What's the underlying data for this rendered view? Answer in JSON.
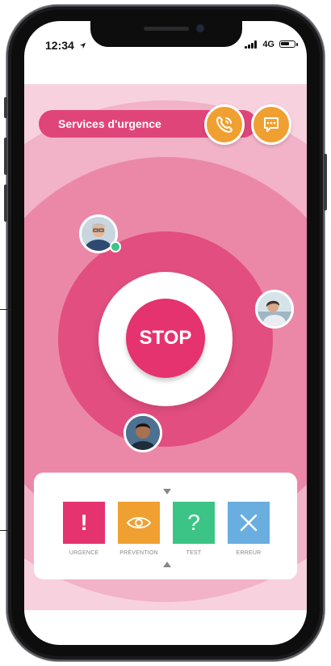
{
  "status": {
    "time": "12:34",
    "network": "4G",
    "battery_level": 0.7
  },
  "services": {
    "label": "Services d'urgence"
  },
  "stop": {
    "label": "STOP"
  },
  "modes": [
    {
      "label": "URGENCE",
      "symbol": "!",
      "color": "#e5336f"
    },
    {
      "label": "PRÉVENTION",
      "symbol": "eye",
      "color": "#f0a030"
    },
    {
      "label": "TEST",
      "symbol": "?",
      "color": "#3cc487"
    },
    {
      "label": "ERREUR",
      "symbol": "×",
      "color": "#6aaee0"
    }
  ],
  "colors": {
    "background": "#f7d2de",
    "accent": "#e5336f",
    "orange": "#f0a030",
    "green": "#3cc487",
    "blue": "#6aaee0"
  }
}
